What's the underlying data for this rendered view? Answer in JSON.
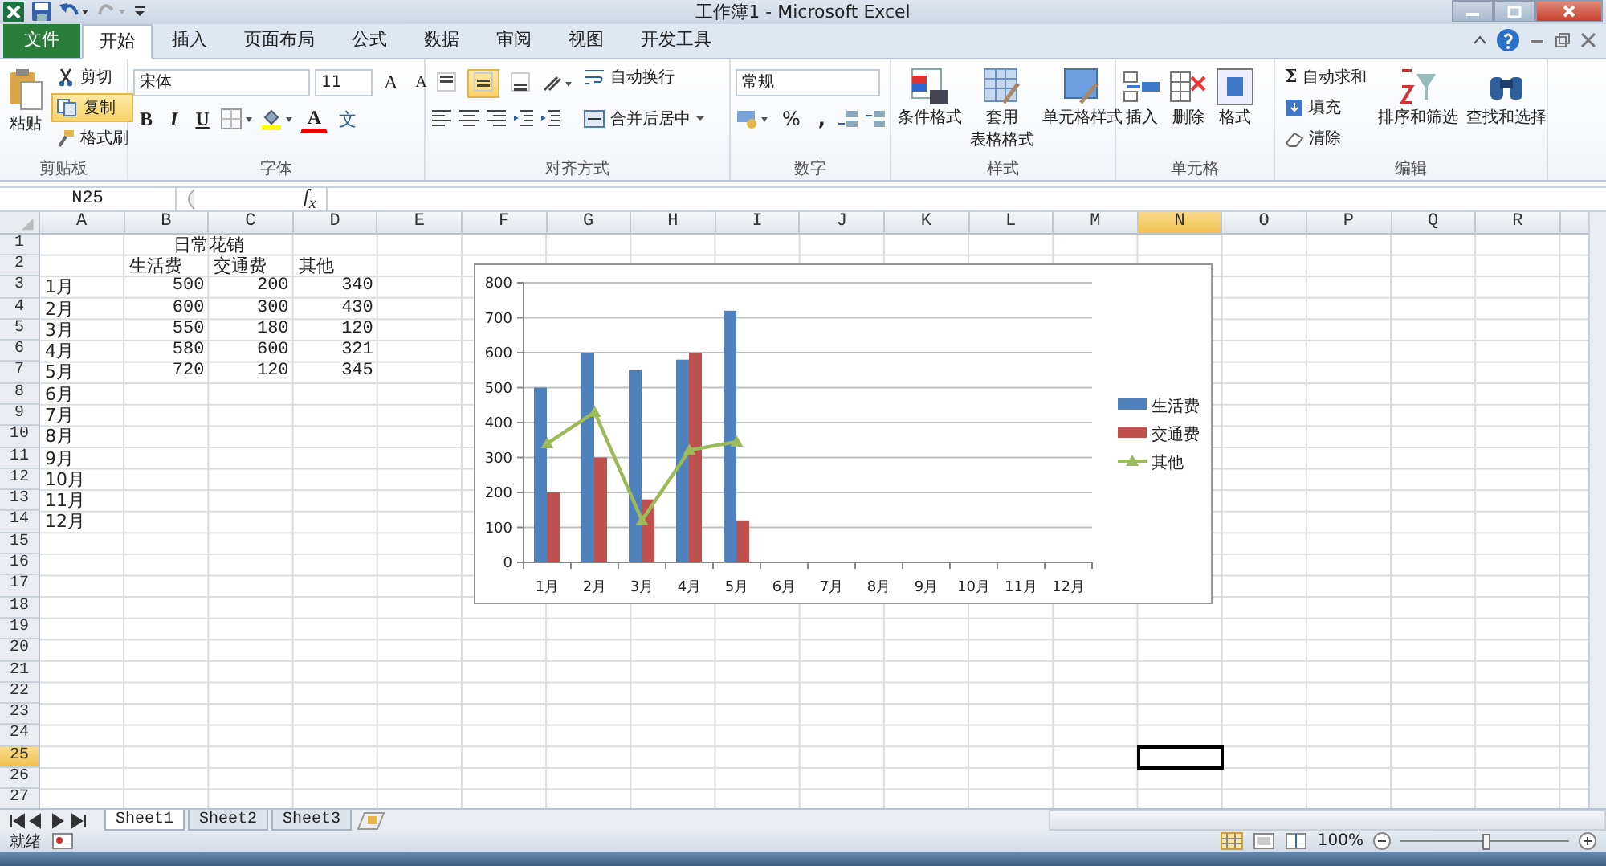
{
  "window": {
    "title": "工作簿1 - Microsoft Excel"
  },
  "tabs": [
    {
      "label": "文件",
      "kind": "file",
      "selected": false
    },
    {
      "label": "开始",
      "kind": "tab",
      "selected": true
    },
    {
      "label": "插入",
      "kind": "tab",
      "selected": false
    },
    {
      "label": "页面布局",
      "kind": "tab",
      "selected": false
    },
    {
      "label": "公式",
      "kind": "tab",
      "selected": false
    },
    {
      "label": "数据",
      "kind": "tab",
      "selected": false
    },
    {
      "label": "审阅",
      "kind": "tab",
      "selected": false
    },
    {
      "label": "视图",
      "kind": "tab",
      "selected": false
    },
    {
      "label": "开发工具",
      "kind": "tab",
      "selected": false
    }
  ],
  "ribbon": {
    "clipboard": {
      "label": "剪贴板",
      "paste": "粘贴",
      "cut": "剪切",
      "copy": {
        "label": "复制",
        "selected": true
      },
      "format_painter": "格式刷"
    },
    "font": {
      "label": "字体",
      "family": "宋体",
      "size": "11",
      "grow": "A",
      "shrink": "A",
      "bold": "B",
      "italic": "I",
      "underline": "U",
      "text_color_letter": "A",
      "phonetic": "文"
    },
    "alignment": {
      "label": "对齐方式",
      "vertical": [
        {
          "selected": false
        },
        {
          "selected": true
        },
        {
          "selected": false
        }
      ],
      "wrap": "自动换行",
      "merge": "合并后居中"
    },
    "number": {
      "label": "数字",
      "format": "常规",
      "percent": "%",
      "comma": ","
    },
    "styles": {
      "label": "样式",
      "conditional": "条件格式",
      "table": "套用",
      "table_2": "表格格式",
      "cell_styles": "单元格样式"
    },
    "cells": {
      "label": "单元格",
      "insert": "插入",
      "delete": "删除",
      "format": "格式"
    },
    "editing": {
      "label": "编辑",
      "sum_symbol": "Σ",
      "autosum": "自动求和",
      "fill": "填充",
      "clear": "清除",
      "sort": "排序和筛选",
      "find": "查找和选择"
    }
  },
  "formula_bar": {
    "name_box": "N25",
    "fx": "f$_{x}$"
  },
  "sheet": {
    "columns": [
      {
        "label": "A",
        "selected": false
      },
      {
        "label": "B",
        "selected": false
      },
      {
        "label": "C",
        "selected": false
      },
      {
        "label": "D",
        "selected": false
      },
      {
        "label": "E",
        "selected": false
      },
      {
        "label": "F",
        "selected": false
      },
      {
        "label": "G",
        "selected": false
      },
      {
        "label": "H",
        "selected": false
      },
      {
        "label": "I",
        "selected": false
      },
      {
        "label": "J",
        "selected": false
      },
      {
        "label": "K",
        "selected": false
      },
      {
        "label": "L",
        "selected": false
      },
      {
        "label": "M",
        "selected": false
      },
      {
        "label": "N",
        "selected": true
      },
      {
        "label": "O",
        "selected": false
      },
      {
        "label": "P",
        "selected": false
      },
      {
        "label": "Q",
        "selected": false
      },
      {
        "label": "R",
        "selected": false
      }
    ],
    "row_headers": [
      {
        "number": "1",
        "selected": false
      },
      {
        "number": "2",
        "selected": false
      },
      {
        "number": "3",
        "selected": false
      },
      {
        "number": "4",
        "selected": false
      },
      {
        "number": "5",
        "selected": false
      },
      {
        "number": "6",
        "selected": false
      },
      {
        "number": "7",
        "selected": false
      },
      {
        "number": "8",
        "selected": false
      },
      {
        "number": "9",
        "selected": false
      },
      {
        "number": "10",
        "selected": false
      },
      {
        "number": "11",
        "selected": false
      },
      {
        "number": "12",
        "selected": false
      },
      {
        "number": "13",
        "selected": false
      },
      {
        "number": "14",
        "selected": false
      },
      {
        "number": "15",
        "selected": false
      },
      {
        "number": "16",
        "selected": false
      },
      {
        "number": "17",
        "selected": false
      },
      {
        "number": "18",
        "selected": false
      },
      {
        "number": "19",
        "selected": false
      },
      {
        "number": "20",
        "selected": false
      },
      {
        "number": "21",
        "selected": false
      },
      {
        "number": "22",
        "selected": false
      },
      {
        "number": "23",
        "selected": false
      },
      {
        "number": "24",
        "selected": false
      },
      {
        "number": "25",
        "selected": true
      },
      {
        "number": "26",
        "selected": false
      },
      {
        "number": "27",
        "selected": false
      }
    ],
    "title": "日常花销",
    "header": [
      "生活费",
      "交通费",
      "其他"
    ],
    "data_rows": [
      {
        "label": "1月",
        "values": [
          "500",
          "200",
          "340"
        ]
      },
      {
        "label": "2月",
        "values": [
          "600",
          "300",
          "430"
        ]
      },
      {
        "label": "3月",
        "values": [
          "550",
          "180",
          "120"
        ]
      },
      {
        "label": "4月",
        "values": [
          "580",
          "600",
          "321"
        ]
      },
      {
        "label": "5月",
        "values": [
          "720",
          "120",
          "345"
        ]
      },
      {
        "label": "6月"
      },
      {
        "label": "7月"
      },
      {
        "label": "8月"
      },
      {
        "label": "9月"
      },
      {
        "label": "10月"
      },
      {
        "label": "11月"
      },
      {
        "label": "12月"
      }
    ],
    "chart_data": {
      "type": "bar",
      "stacked": false,
      "grid": true,
      "legend": true,
      "categories": [
        "1月",
        "2月",
        "3月",
        "4月",
        "5月",
        "6月",
        "7月",
        "8月",
        "9月",
        "10月",
        "11月",
        "12月"
      ],
      "ylim": [
        0,
        800
      ],
      "yticks": [
        {
          "value": 0,
          "label": "0"
        },
        {
          "value": 100,
          "label": "100"
        },
        {
          "value": 200,
          "label": "200"
        },
        {
          "value": 300,
          "label": "300"
        },
        {
          "value": 400,
          "label": "400"
        },
        {
          "value": 500,
          "label": "500"
        },
        {
          "value": 600,
          "label": "600"
        },
        {
          "value": 700,
          "label": "700"
        },
        {
          "value": 800,
          "label": "800"
        }
      ],
      "series": [
        {
          "name": "生活费",
          "type": "bar",
          "color": "#4f81bd",
          "values": [
            500,
            600,
            550,
            580,
            720,
            null,
            null,
            null,
            null,
            null,
            null,
            null
          ]
        },
        {
          "name": "交通费",
          "type": "bar",
          "color": "#c0504d",
          "values": [
            200,
            300,
            180,
            600,
            120,
            null,
            null,
            null,
            null,
            null,
            null,
            null
          ]
        },
        {
          "name": "其他",
          "type": "line",
          "marker": "triangle",
          "color": "#9bbb59",
          "values": [
            340,
            430,
            120,
            321,
            345,
            null,
            null,
            null,
            null,
            null,
            null,
            null
          ]
        }
      ]
    }
  },
  "sheet_tabs": [
    {
      "label": "Sheet1",
      "selected": true
    },
    {
      "label": "Sheet2",
      "selected": false
    },
    {
      "label": "Sheet3",
      "selected": false
    }
  ],
  "status_bar": {
    "status": "就绪",
    "zoom": "100%",
    "level": 0.5
  }
}
